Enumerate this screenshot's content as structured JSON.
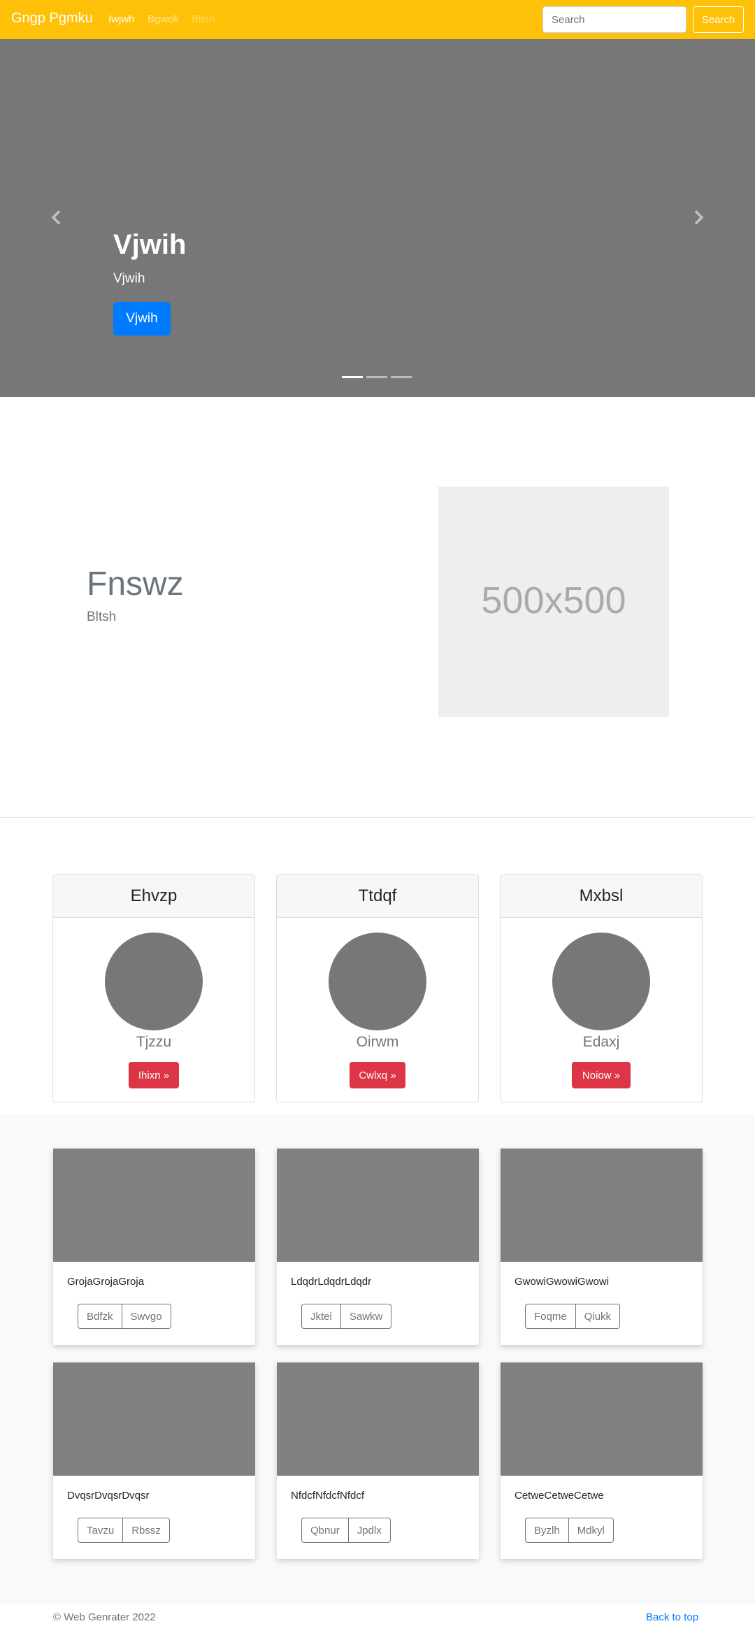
{
  "navbar": {
    "brand": "Gngp Pgmku",
    "links": [
      "Iwjwh",
      "Bgwok",
      "Bltsh"
    ],
    "search_placeholder": "Search",
    "search_button": "Search"
  },
  "carousel": {
    "title": "Vjwih",
    "subtitle": "Vjwih",
    "button": "Vjwih",
    "slide_count": 3,
    "active_slide": 1
  },
  "feature": {
    "title": "Fnswz",
    "subtitle": "Bltsh",
    "image_placeholder": "500x500"
  },
  "profile_cards": [
    {
      "title": "Ehvzp",
      "name": "Tjzzu",
      "button": "Ihixn »"
    },
    {
      "title": "Ttdqf",
      "name": "Oirwm",
      "button": "Cwlxq »"
    },
    {
      "title": "Mxbsl",
      "name": "Edaxj",
      "button": "Noiow »"
    }
  ],
  "gallery": [
    {
      "text": "GrojaGrojaGroja",
      "buttons": [
        "Bdfzk",
        "Swvgo"
      ]
    },
    {
      "text": "LdqdrLdqdrLdqdr",
      "buttons": [
        "Jktei",
        "Sawkw"
      ]
    },
    {
      "text": "GwowiGwowiGwowi",
      "buttons": [
        "Foqme",
        "Qiukk"
      ]
    },
    {
      "text": "DvqsrDvqsrDvqsr",
      "buttons": [
        "Tavzu",
        "Rbssz"
      ]
    },
    {
      "text": "NfdcfNfdcfNfdcf",
      "buttons": [
        "Qbnur",
        "Jpdlx"
      ]
    },
    {
      "text": "CetweCetweCetwe",
      "buttons": [
        "Byzlh",
        "Mdkyl"
      ]
    }
  ],
  "footer": {
    "copyright": "© Web Genrater 2022",
    "back_to_top": "Back to top"
  },
  "colors": {
    "navbar": "#ffc107",
    "primary": "#007bff",
    "danger": "#dc3545",
    "carousel_bg": "#777777"
  }
}
